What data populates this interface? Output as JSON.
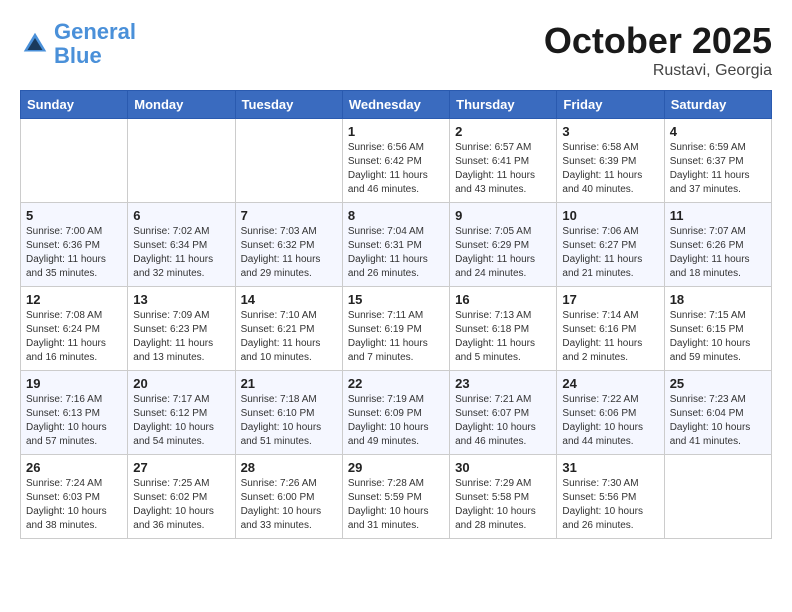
{
  "header": {
    "logo_line1": "General",
    "logo_line2": "Blue",
    "month_title": "October 2025",
    "location": "Rustavi, Georgia"
  },
  "days_of_week": [
    "Sunday",
    "Monday",
    "Tuesday",
    "Wednesday",
    "Thursday",
    "Friday",
    "Saturday"
  ],
  "weeks": [
    [
      {
        "day": "",
        "info": ""
      },
      {
        "day": "",
        "info": ""
      },
      {
        "day": "",
        "info": ""
      },
      {
        "day": "1",
        "info": "Sunrise: 6:56 AM\nSunset: 6:42 PM\nDaylight: 11 hours\nand 46 minutes."
      },
      {
        "day": "2",
        "info": "Sunrise: 6:57 AM\nSunset: 6:41 PM\nDaylight: 11 hours\nand 43 minutes."
      },
      {
        "day": "3",
        "info": "Sunrise: 6:58 AM\nSunset: 6:39 PM\nDaylight: 11 hours\nand 40 minutes."
      },
      {
        "day": "4",
        "info": "Sunrise: 6:59 AM\nSunset: 6:37 PM\nDaylight: 11 hours\nand 37 minutes."
      }
    ],
    [
      {
        "day": "5",
        "info": "Sunrise: 7:00 AM\nSunset: 6:36 PM\nDaylight: 11 hours\nand 35 minutes."
      },
      {
        "day": "6",
        "info": "Sunrise: 7:02 AM\nSunset: 6:34 PM\nDaylight: 11 hours\nand 32 minutes."
      },
      {
        "day": "7",
        "info": "Sunrise: 7:03 AM\nSunset: 6:32 PM\nDaylight: 11 hours\nand 29 minutes."
      },
      {
        "day": "8",
        "info": "Sunrise: 7:04 AM\nSunset: 6:31 PM\nDaylight: 11 hours\nand 26 minutes."
      },
      {
        "day": "9",
        "info": "Sunrise: 7:05 AM\nSunset: 6:29 PM\nDaylight: 11 hours\nand 24 minutes."
      },
      {
        "day": "10",
        "info": "Sunrise: 7:06 AM\nSunset: 6:27 PM\nDaylight: 11 hours\nand 21 minutes."
      },
      {
        "day": "11",
        "info": "Sunrise: 7:07 AM\nSunset: 6:26 PM\nDaylight: 11 hours\nand 18 minutes."
      }
    ],
    [
      {
        "day": "12",
        "info": "Sunrise: 7:08 AM\nSunset: 6:24 PM\nDaylight: 11 hours\nand 16 minutes."
      },
      {
        "day": "13",
        "info": "Sunrise: 7:09 AM\nSunset: 6:23 PM\nDaylight: 11 hours\nand 13 minutes."
      },
      {
        "day": "14",
        "info": "Sunrise: 7:10 AM\nSunset: 6:21 PM\nDaylight: 11 hours\nand 10 minutes."
      },
      {
        "day": "15",
        "info": "Sunrise: 7:11 AM\nSunset: 6:19 PM\nDaylight: 11 hours\nand 7 minutes."
      },
      {
        "day": "16",
        "info": "Sunrise: 7:13 AM\nSunset: 6:18 PM\nDaylight: 11 hours\nand 5 minutes."
      },
      {
        "day": "17",
        "info": "Sunrise: 7:14 AM\nSunset: 6:16 PM\nDaylight: 11 hours\nand 2 minutes."
      },
      {
        "day": "18",
        "info": "Sunrise: 7:15 AM\nSunset: 6:15 PM\nDaylight: 10 hours\nand 59 minutes."
      }
    ],
    [
      {
        "day": "19",
        "info": "Sunrise: 7:16 AM\nSunset: 6:13 PM\nDaylight: 10 hours\nand 57 minutes."
      },
      {
        "day": "20",
        "info": "Sunrise: 7:17 AM\nSunset: 6:12 PM\nDaylight: 10 hours\nand 54 minutes."
      },
      {
        "day": "21",
        "info": "Sunrise: 7:18 AM\nSunset: 6:10 PM\nDaylight: 10 hours\nand 51 minutes."
      },
      {
        "day": "22",
        "info": "Sunrise: 7:19 AM\nSunset: 6:09 PM\nDaylight: 10 hours\nand 49 minutes."
      },
      {
        "day": "23",
        "info": "Sunrise: 7:21 AM\nSunset: 6:07 PM\nDaylight: 10 hours\nand 46 minutes."
      },
      {
        "day": "24",
        "info": "Sunrise: 7:22 AM\nSunset: 6:06 PM\nDaylight: 10 hours\nand 44 minutes."
      },
      {
        "day": "25",
        "info": "Sunrise: 7:23 AM\nSunset: 6:04 PM\nDaylight: 10 hours\nand 41 minutes."
      }
    ],
    [
      {
        "day": "26",
        "info": "Sunrise: 7:24 AM\nSunset: 6:03 PM\nDaylight: 10 hours\nand 38 minutes."
      },
      {
        "day": "27",
        "info": "Sunrise: 7:25 AM\nSunset: 6:02 PM\nDaylight: 10 hours\nand 36 minutes."
      },
      {
        "day": "28",
        "info": "Sunrise: 7:26 AM\nSunset: 6:00 PM\nDaylight: 10 hours\nand 33 minutes."
      },
      {
        "day": "29",
        "info": "Sunrise: 7:28 AM\nSunset: 5:59 PM\nDaylight: 10 hours\nand 31 minutes."
      },
      {
        "day": "30",
        "info": "Sunrise: 7:29 AM\nSunset: 5:58 PM\nDaylight: 10 hours\nand 28 minutes."
      },
      {
        "day": "31",
        "info": "Sunrise: 7:30 AM\nSunset: 5:56 PM\nDaylight: 10 hours\nand 26 minutes."
      },
      {
        "day": "",
        "info": ""
      }
    ]
  ]
}
